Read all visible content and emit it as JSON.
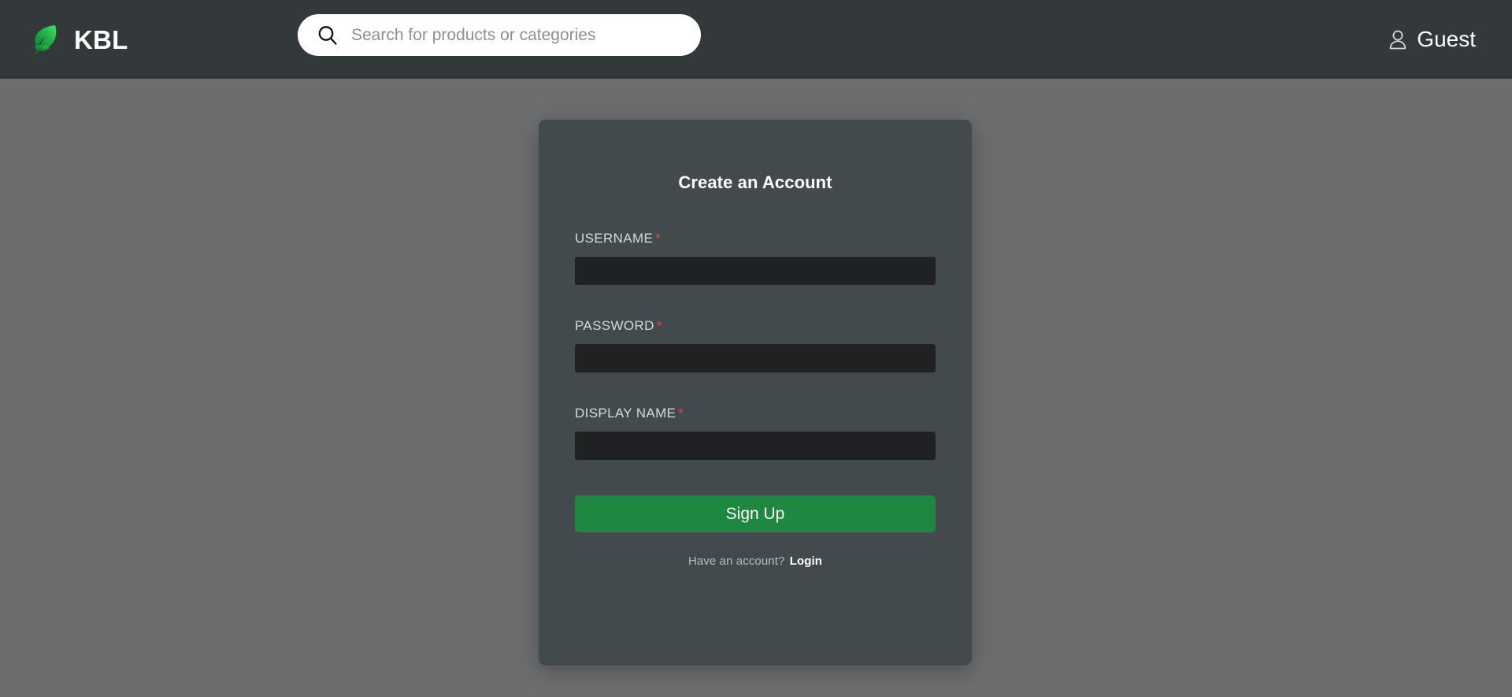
{
  "header": {
    "brand_name": "KBL",
    "brand_logo_icon": "leaf-icon",
    "brand_logo_colors": {
      "light": "#3ad35a",
      "mid": "#22b14c",
      "dark": "#0a7a2e"
    },
    "search": {
      "icon": "search-icon",
      "placeholder": "Search for products or categories",
      "value": ""
    },
    "account": {
      "icon": "user-icon",
      "label": "Guest"
    },
    "background_color": "#33393b"
  },
  "page": {
    "background_color": "#6c6d6f"
  },
  "signup_card": {
    "title": "Create an Account",
    "background_color": "#434a4d",
    "fields": [
      {
        "label": "USERNAME",
        "required_marker": "*",
        "value": "",
        "placeholder": "",
        "type": "text"
      },
      {
        "label": "PASSWORD",
        "required_marker": "*",
        "value": "",
        "placeholder": "",
        "type": "password"
      },
      {
        "label": "DISPLAY NAME",
        "required_marker": "*",
        "value": "",
        "placeholder": "",
        "type": "text"
      }
    ],
    "submit_label": "Sign Up",
    "submit_color": "#1e8840",
    "footer_text": "Have an account?",
    "footer_link_label": "Login",
    "required_marker_color": "#e8413c"
  }
}
